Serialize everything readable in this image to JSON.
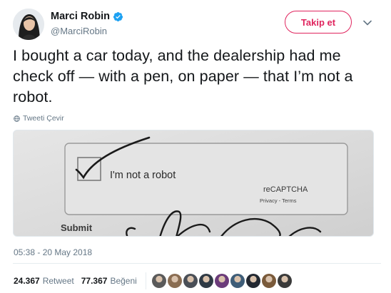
{
  "author": {
    "name": "Marci Robin",
    "handle": "@MarciRobin",
    "verified": true
  },
  "follow_label": "Takip et",
  "tweet_text": "I bought a car today, and the dealership had me check off — with a pen, on paper — that I’m not a robot.",
  "translate_label": "Tweeti Çevir",
  "media": {
    "checkbox_label": "I'm not a robot",
    "brand": "reCAPTCHA",
    "links": "Privacy - Terms",
    "submit_label": "Submit"
  },
  "timestamp": "05:38 - 20 May 2018",
  "stats": {
    "retweets_count": "24.367",
    "retweets_label": "Retweet",
    "likes_count": "77.367",
    "likes_label": "Beğeni"
  },
  "colors": {
    "accent": "#e0245e",
    "verified": "#1da1f2",
    "secondary_text": "#657786"
  },
  "likers": [
    {
      "icon": "avatar-1",
      "color": "#5a5a5a"
    },
    {
      "icon": "avatar-2",
      "color": "#8a6d52"
    },
    {
      "icon": "avatar-3",
      "color": "#4a4f57"
    },
    {
      "icon": "avatar-4",
      "color": "#2f3a45"
    },
    {
      "icon": "avatar-5",
      "color": "#6b3b7a"
    },
    {
      "icon": "avatar-6",
      "color": "#3e5d78"
    },
    {
      "icon": "avatar-7",
      "color": "#222831"
    },
    {
      "icon": "avatar-8",
      "color": "#7a5a3a"
    },
    {
      "icon": "avatar-9",
      "color": "#3a3a3a"
    }
  ]
}
